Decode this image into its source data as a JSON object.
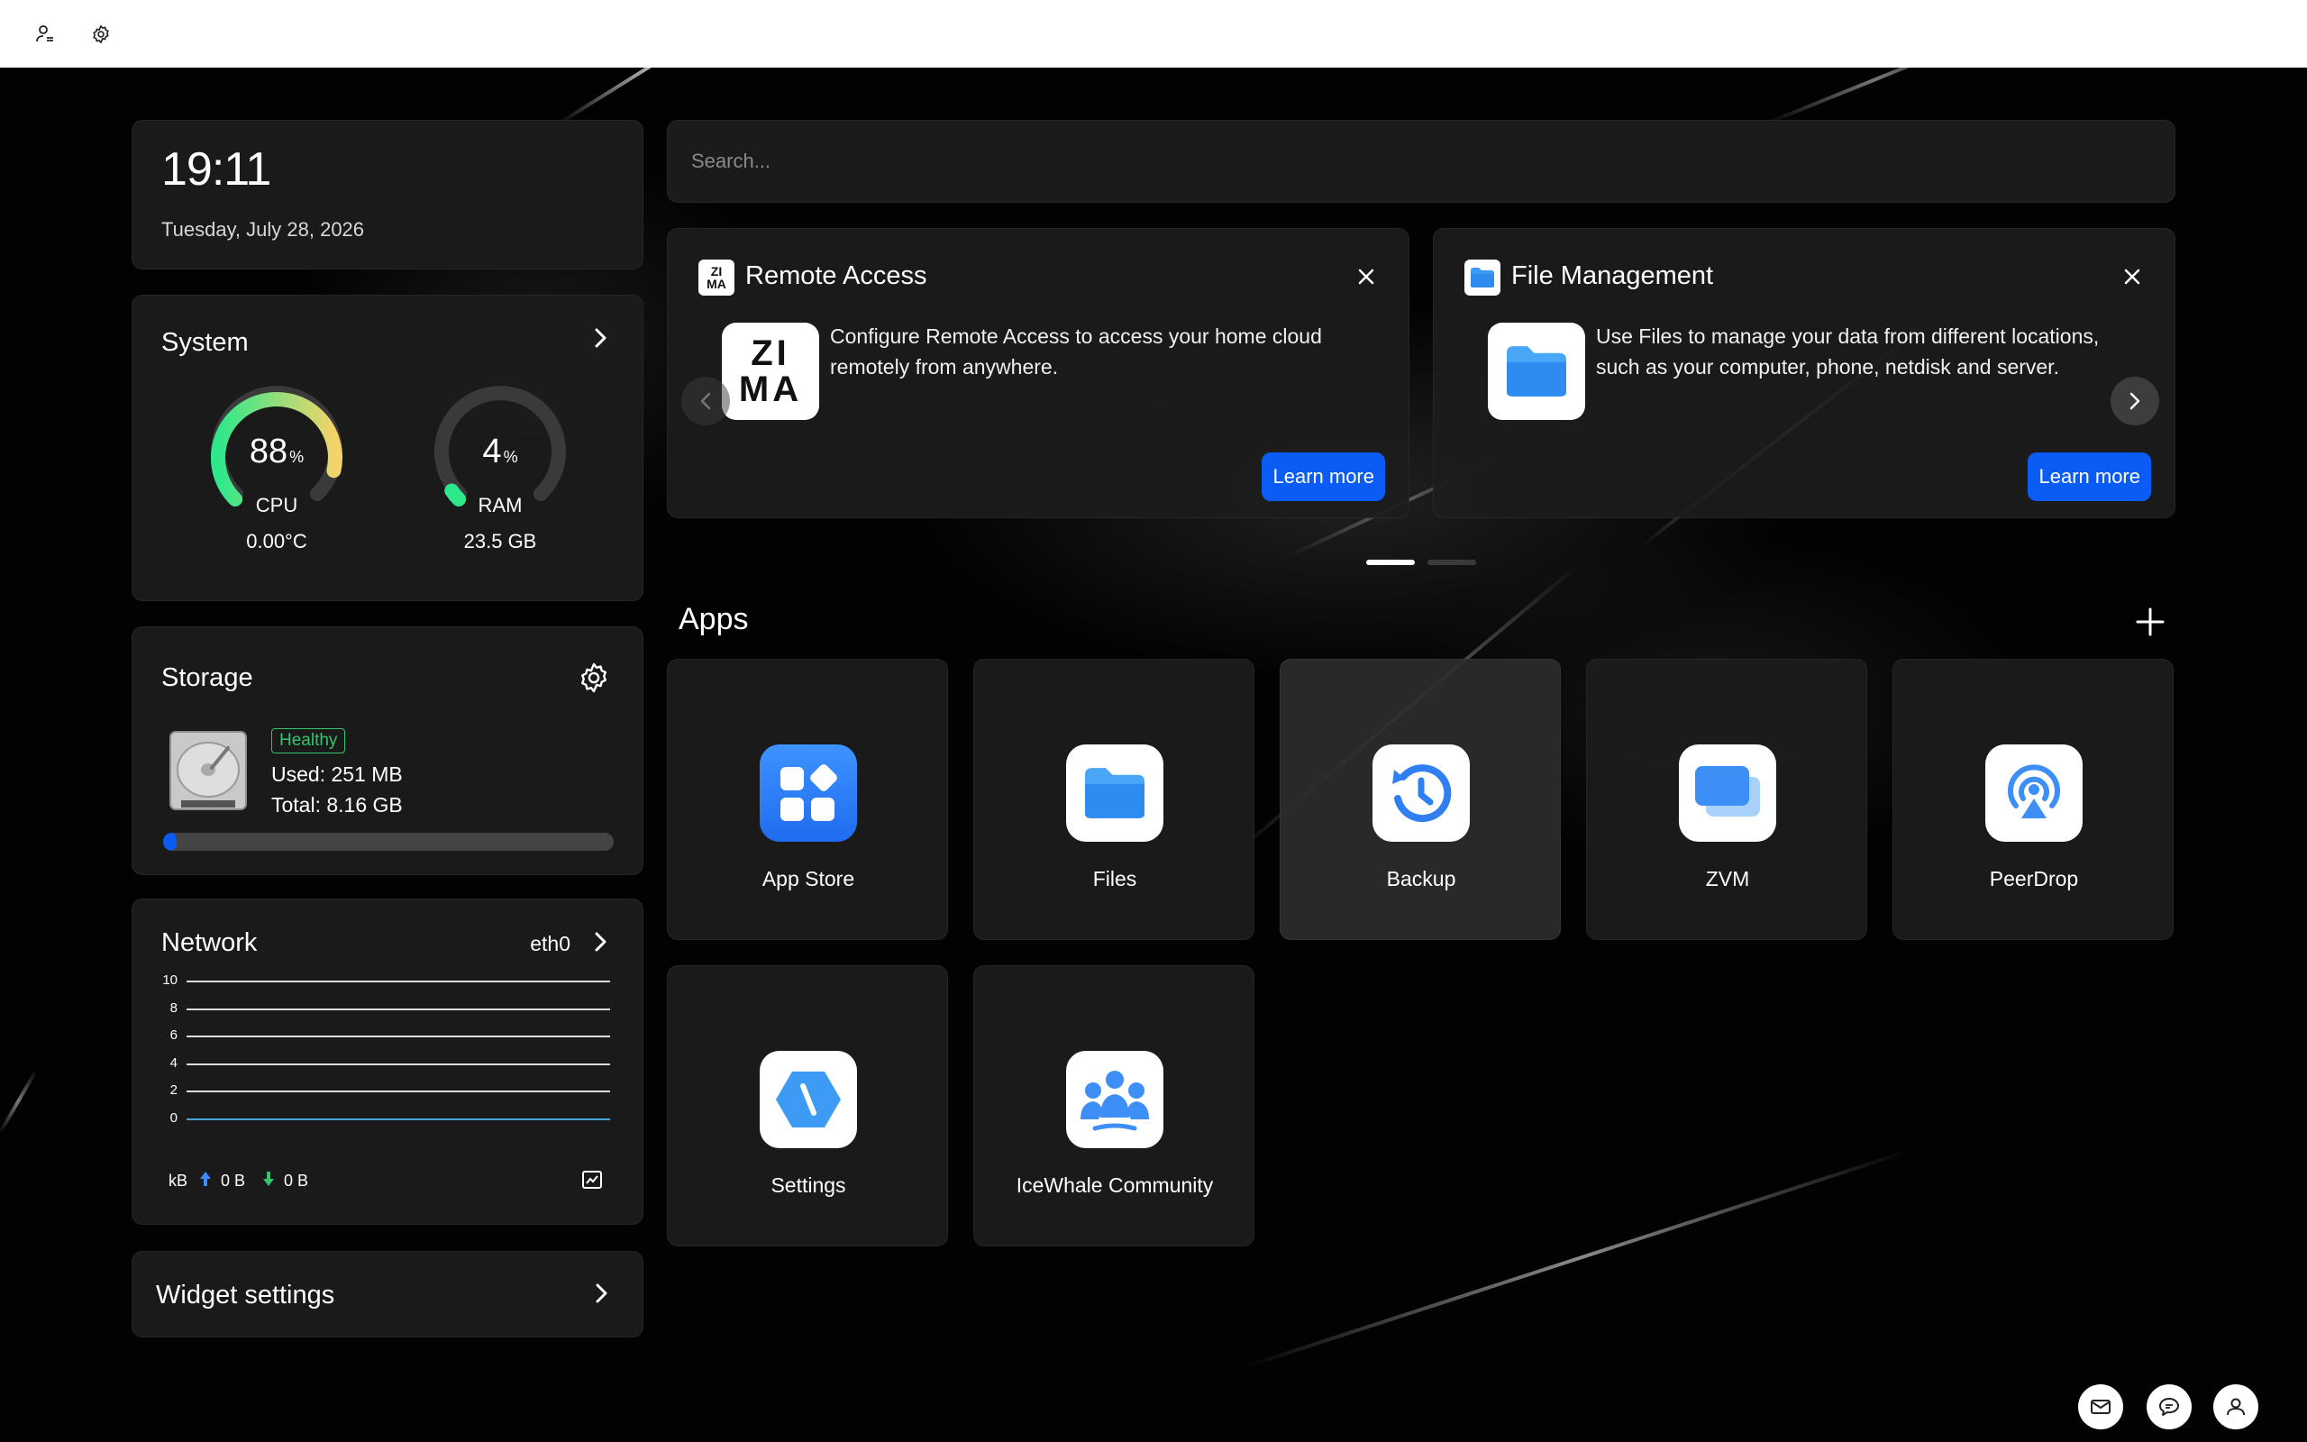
{
  "topbar": {
    "icons": [
      "user-settings-icon",
      "gear-icon"
    ]
  },
  "clock": {
    "time": "19:11",
    "date": "Tuesday, July 28, 2026"
  },
  "system": {
    "title": "System",
    "cpu": {
      "percent": 88,
      "value": "88",
      "unit": "%",
      "label": "CPU",
      "sub": "0.00°C",
      "color_start": "#2ee88c",
      "color_end": "#f4d46a"
    },
    "ram": {
      "percent": 4,
      "value": "4",
      "unit": "%",
      "label": "RAM",
      "sub": "23.5 GB",
      "color": "#2ee88c"
    }
  },
  "storage": {
    "title": "Storage",
    "status": "Healthy",
    "used": "Used: 251 MB",
    "total": "Total: 8.16 GB",
    "fill_fraction": 0.03,
    "accent": "#0a5cf5"
  },
  "network": {
    "title": "Network",
    "interface": "eth0",
    "y_ticks": [
      "10",
      "8",
      "6",
      "4",
      "2",
      "0"
    ],
    "unit": "kB",
    "upload": "0 B",
    "download": "0 B"
  },
  "widget_settings": {
    "label": "Widget settings"
  },
  "search": {
    "placeholder": "Search..."
  },
  "promos": [
    {
      "title": "Remote Access",
      "desc_line1": "Configure Remote Access to access your home cloud",
      "desc_line2": "remotely from anywhere.",
      "button": "Learn more",
      "icon_text_top": "ZI",
      "icon_text_bottom": "MA"
    },
    {
      "title": "File Management",
      "desc_line1": "Use Files to manage your data from different locations,",
      "desc_line2": "such as your computer, phone, netdisk and server.",
      "button": "Learn more"
    }
  ],
  "apps": {
    "title": "Apps",
    "items": [
      {
        "name": "App Store"
      },
      {
        "name": "Files"
      },
      {
        "name": "Backup"
      },
      {
        "name": "ZVM"
      },
      {
        "name": "PeerDrop"
      },
      {
        "name": "Settings"
      },
      {
        "name": "IceWhale Community"
      }
    ]
  },
  "bottom_buttons": [
    "mail-icon",
    "chat-icon",
    "account-icon"
  ]
}
